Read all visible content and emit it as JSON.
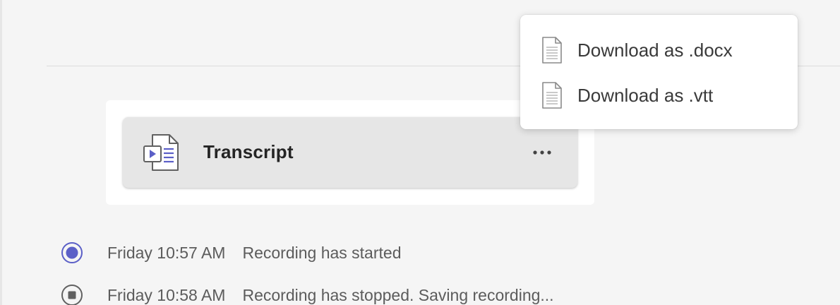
{
  "transcript": {
    "title": "Transcript",
    "icon": "transcript-file-icon",
    "more_icon": "more-options-icon"
  },
  "menu": {
    "items": [
      {
        "label": "Download as .docx",
        "icon": "document-icon"
      },
      {
        "label": "Download as .vtt",
        "icon": "document-icon"
      }
    ]
  },
  "events": [
    {
      "time": "Friday 10:57 AM",
      "text": "Recording has started",
      "icon": "recording-started-icon",
      "color": "#5b5fc7"
    },
    {
      "time": "Friday 10:58 AM",
      "text": "Recording has stopped. Saving recording...",
      "icon": "recording-stopped-icon",
      "color": "#616161"
    }
  ],
  "colors": {
    "accent": "#5b5fc7",
    "background": "#f5f5f5",
    "card": "#e6e6e6"
  }
}
